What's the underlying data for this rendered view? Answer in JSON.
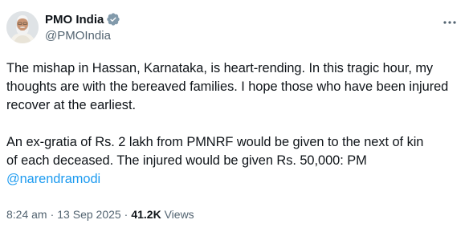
{
  "author": {
    "display_name": "PMO India",
    "handle": "@PMOIndia",
    "verified_color": "#829aab"
  },
  "tweet": {
    "paragraph1": "The mishap in Hassan, Karnataka, is heart-rending. In this tragic hour, my thoughts are with the bereaved families. I hope those who have been injured recover at the earliest.",
    "paragraph2_line1": "An ex-gratia of Rs. 2 lakh from PMNRF would be given to the next of kin",
    "paragraph2_line2": "of each deceased. The injured would be given Rs. 50,000: PM",
    "mention": "@narendramodi"
  },
  "meta": {
    "time": "8:24 am",
    "separator": "·",
    "date": "13 Sep 2025",
    "views_count": "41.2K",
    "views_label": "Views"
  },
  "icons": {
    "avatar": "avatar-portrait",
    "verified": "verified-badge-icon",
    "more": "more-options-icon"
  },
  "colors": {
    "text": "#0f1419",
    "secondary": "#536471",
    "link": "#1d9bf0"
  }
}
